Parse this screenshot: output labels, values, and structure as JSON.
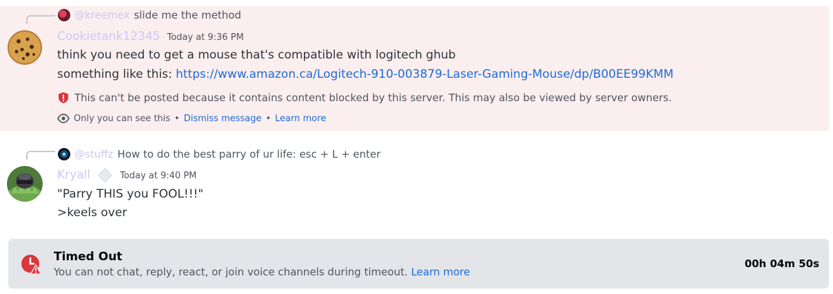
{
  "messages": [
    {
      "reply": {
        "mention": "@kreemex",
        "text": "slide me the method"
      },
      "username": "Cookietank12345",
      "timestamp": "Today at 9:36 PM",
      "lines": [
        "think you need to get a mouse that's compatible with logitech ghub",
        "something like this: "
      ],
      "link": "https://www.amazon.ca/Logitech-910-003879-Laser-Gaming-Mouse/dp/B00EE99KMM",
      "blocked_notice": "This can't be posted because it contains content blocked by this server. This may also be viewed by server owners.",
      "visibility": {
        "only_you": "Only you can see this",
        "separator": "•",
        "dismiss": "Dismiss message",
        "learn_more": "Learn more"
      }
    },
    {
      "reply": {
        "mention": "@stuffz",
        "text": "How to do the best parry of ur life: esc + L + enter"
      },
      "username": "Kryall",
      "timestamp": "Today at 9:40 PM",
      "lines": [
        "\"Parry THIS you FOOL!!!\"",
        ">keels over"
      ]
    }
  ],
  "timeout": {
    "title": "Timed Out",
    "description": "You can not chat, reply, react, or join voice channels during timeout. ",
    "learn_more": "Learn more",
    "remaining": "00h 04m 50s",
    "icon": "clock-warning-icon"
  },
  "colors": {
    "blocked_bg": "#fbeeee",
    "username": "#c9c9f5",
    "link": "#1e6bd6",
    "timeout_bg": "#e3e5e8",
    "danger": "#da373c"
  }
}
